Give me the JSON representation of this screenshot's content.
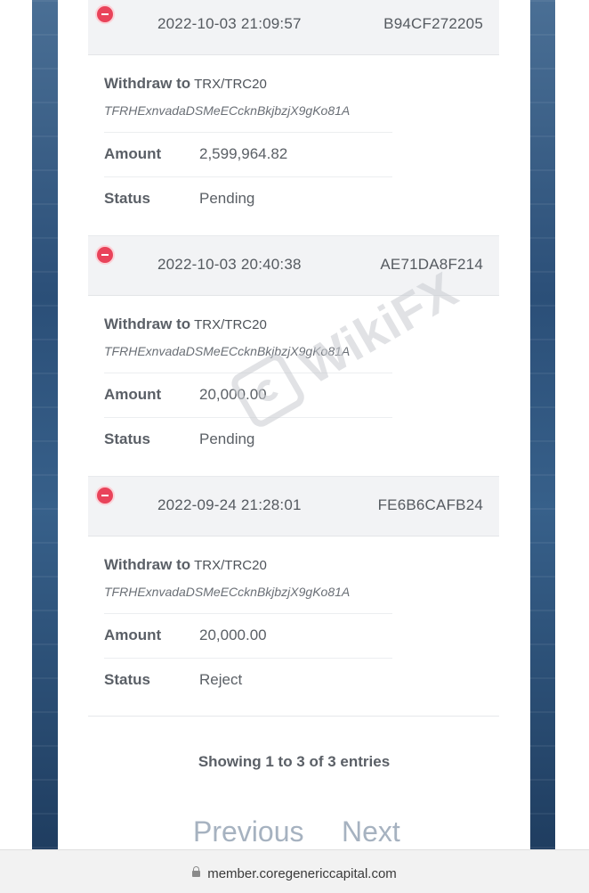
{
  "withdrawals": [
    {
      "datetime": "2022-10-03 21:09:57",
      "ref": "B94CF272205",
      "withdraw_label": "Withdraw to",
      "network": "TRX/TRC20",
      "address": "TFRHExnvadaDSMeECcknBkjbzjX9gKo81A",
      "amount_label": "Amount",
      "amount": "2,599,964.82",
      "status_label": "Status",
      "status": "Pending"
    },
    {
      "datetime": "2022-10-03 20:40:38",
      "ref": "AE71DA8F214",
      "withdraw_label": "Withdraw to",
      "network": "TRX/TRC20",
      "address": "TFRHExnvadaDSMeECcknBkjbzjX9gKo81A",
      "amount_label": "Amount",
      "amount": "20,000.00",
      "status_label": "Status",
      "status": "Pending"
    },
    {
      "datetime": "2022-09-24 21:28:01",
      "ref": "FE6B6CAFB24",
      "withdraw_label": "Withdraw to",
      "network": "TRX/TRC20",
      "address": "TFRHExnvadaDSMeECcknBkjbzjX9gKo81A",
      "amount_label": "Amount",
      "amount": "20,000.00",
      "status_label": "Status",
      "status": "Reject"
    }
  ],
  "pagination": {
    "summary": "Showing 1 to 3 of 3 entries",
    "previous": "Previous",
    "next": "Next"
  },
  "watermark": {
    "text": "WikiFX"
  },
  "browser": {
    "url": "member.coregenericcapital.com",
    "lock_icon": "lock-icon"
  },
  "colors": {
    "remove_button": "#e9435a",
    "pager_text": "#a6b2c0",
    "card_header_bg": "#f2f3f5"
  }
}
